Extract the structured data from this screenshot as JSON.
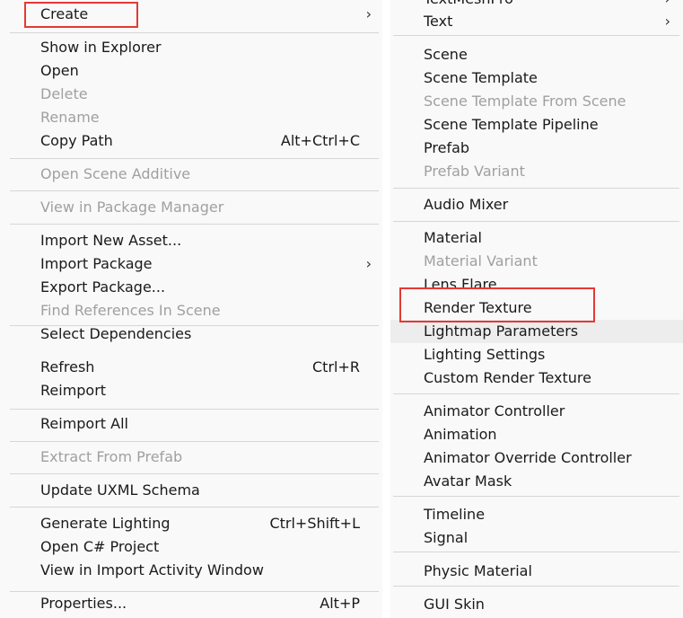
{
  "left_menu": {
    "items": [
      {
        "label": "Create",
        "submenu": true
      },
      {
        "label": "Show in Explorer"
      },
      {
        "label": "Open"
      },
      {
        "label": "Delete",
        "disabled": true
      },
      {
        "label": "Rename",
        "disabled": true
      },
      {
        "label": "Copy Path",
        "shortcut": "Alt+Ctrl+C"
      },
      {
        "label": "Open Scene Additive",
        "disabled": true
      },
      {
        "label": "View in Package Manager",
        "disabled": true
      },
      {
        "label": "Import New Asset..."
      },
      {
        "label": "Import Package",
        "submenu": true
      },
      {
        "label": "Export Package..."
      },
      {
        "label": "Find References In Scene",
        "disabled": true
      },
      {
        "label": "Select Dependencies"
      },
      {
        "label": "Refresh",
        "shortcut": "Ctrl+R"
      },
      {
        "label": "Reimport"
      },
      {
        "label": "Reimport All"
      },
      {
        "label": "Extract From Prefab",
        "disabled": true
      },
      {
        "label": "Update UXML Schema"
      },
      {
        "label": "Generate Lighting",
        "shortcut": "Ctrl+Shift+L"
      },
      {
        "label": "Open C# Project"
      },
      {
        "label": "View in Import Activity Window"
      },
      {
        "label": "Properties...",
        "shortcut": "Alt+P"
      }
    ]
  },
  "right_menu": {
    "items": [
      {
        "label": "TextMeshPro",
        "submenu": true
      },
      {
        "label": "Text",
        "submenu": true
      },
      {
        "label": "Scene"
      },
      {
        "label": "Scene Template"
      },
      {
        "label": "Scene Template From Scene",
        "disabled": true
      },
      {
        "label": "Scene Template Pipeline"
      },
      {
        "label": "Prefab"
      },
      {
        "label": "Prefab Variant",
        "disabled": true
      },
      {
        "label": "Audio Mixer"
      },
      {
        "label": "Material"
      },
      {
        "label": "Material Variant",
        "disabled": true
      },
      {
        "label": "Lens Flare"
      },
      {
        "label": "Render Texture"
      },
      {
        "label": "Lightmap Parameters",
        "hovered": true
      },
      {
        "label": "Lighting Settings"
      },
      {
        "label": "Custom Render Texture"
      },
      {
        "label": "Animator Controller"
      },
      {
        "label": "Animation"
      },
      {
        "label": "Animator Override Controller"
      },
      {
        "label": "Avatar Mask"
      },
      {
        "label": "Timeline"
      },
      {
        "label": "Signal"
      },
      {
        "label": "Physic Material"
      },
      {
        "label": "GUI Skin"
      }
    ]
  },
  "submenu_arrow_glyph": "›",
  "colors": {
    "menu_background": "#f9f9f9",
    "text": "#1a1a1a",
    "disabled_text": "#a0a0a0",
    "separator": "#d6d6d6",
    "hover_background": "#ededed",
    "annotation_box": "#e53935"
  }
}
